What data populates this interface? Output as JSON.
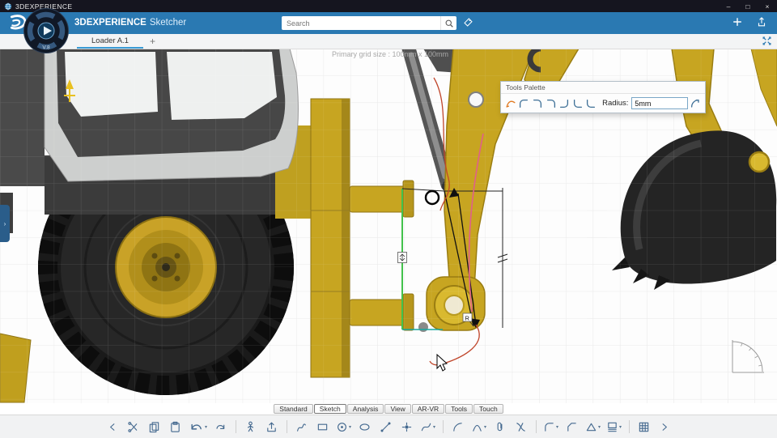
{
  "window": {
    "app_name": "3DEXPERIENCE",
    "controls": [
      "–",
      "□",
      "×"
    ]
  },
  "header": {
    "brand": "3DEXPERIENCE",
    "product": "Sketcher",
    "search_placeholder": "Search",
    "icons": [
      "tag",
      "add",
      "share"
    ]
  },
  "compass": {
    "version": "V.8"
  },
  "tabbar": {
    "tabs": [
      {
        "label": "Loader A.1",
        "active": true
      }
    ],
    "add_label": "+"
  },
  "canvas": {
    "grid_note": "Primary grid size : 100mm x 100mm",
    "radius_flag": "R"
  },
  "tools_palette": {
    "title": "Tools Palette",
    "radius_label": "Radius:",
    "radius_value": "5mm",
    "icons": [
      "sketch-arc",
      "corner-trim-1",
      "corner-trim-2",
      "corner-trim-3",
      "corner-trim-4",
      "corner-trim-5",
      "corner-trim-6",
      "auto-radius"
    ]
  },
  "bottom_tabs": {
    "items": [
      "Standard",
      "Sketch",
      "Analysis",
      "View",
      "AR-VR",
      "Tools",
      "Touch"
    ],
    "active": "Sketch"
  },
  "toolbar": {
    "icons": [
      {
        "name": "collapse"
      },
      {
        "name": "cut"
      },
      {
        "name": "copy"
      },
      {
        "name": "paste"
      },
      {
        "name": "undo",
        "big": true,
        "caret": true
      },
      {
        "name": "redo"
      },
      {
        "sep": true
      },
      {
        "name": "manikin"
      },
      {
        "name": "export"
      },
      {
        "sep": true
      },
      {
        "name": "profile"
      },
      {
        "name": "rectangle"
      },
      {
        "name": "circle",
        "caret": true
      },
      {
        "name": "ellipse"
      },
      {
        "name": "line"
      },
      {
        "name": "point"
      },
      {
        "name": "spline",
        "caret": true
      },
      {
        "sep": true
      },
      {
        "name": "arc"
      },
      {
        "name": "conic",
        "caret": true
      },
      {
        "name": "attach"
      },
      {
        "name": "trim"
      },
      {
        "sep": true
      },
      {
        "name": "corner",
        "caret": true
      },
      {
        "name": "chamfer"
      },
      {
        "name": "triangle",
        "caret": true
      },
      {
        "name": "layers",
        "caret": true
      },
      {
        "sep": true
      },
      {
        "name": "grid"
      },
      {
        "name": "expand"
      }
    ]
  },
  "colors": {
    "header_blue": "#2a79b2",
    "titlebar_dark": "#15151f",
    "vehicle_yellow": "#c7a521",
    "sketch_green": "#43c24b",
    "tab_accent": "#3a9bd5"
  }
}
